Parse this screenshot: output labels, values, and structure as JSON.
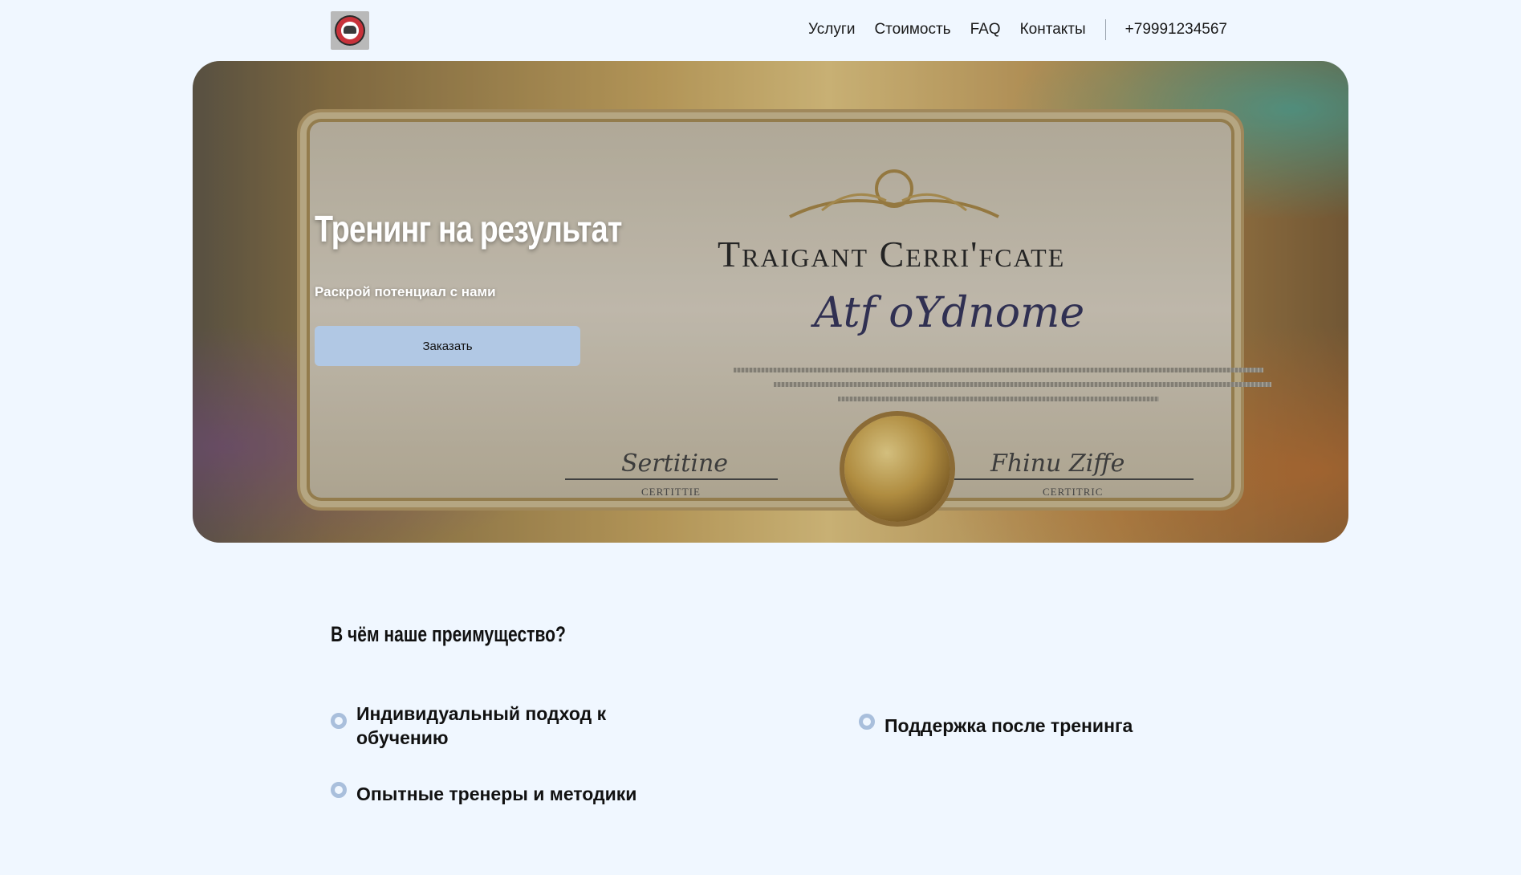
{
  "header": {
    "logo_icon": "company-logo",
    "nav": [
      {
        "label": "Услуги"
      },
      {
        "label": "Стоимость"
      },
      {
        "label": "FAQ"
      },
      {
        "label": "Контакты"
      }
    ],
    "phone": "+79991234567"
  },
  "hero": {
    "title": "Тренинг на результат",
    "subtitle": "Раскрой потенциал с нами",
    "button_label": "Заказать",
    "button_color": "#b1c8e4",
    "image": {
      "cert_title": "Traigant Cerri'fcate",
      "cert_script": "Atf oYdnome",
      "sig_left": "Sertitine",
      "sig_right": "Fhinu Ziffe",
      "sig_left_caption": "CERTITTIE",
      "sig_right_caption": "CERTITRIC"
    }
  },
  "advantages": {
    "title": "В чём наше преимущество?",
    "bullet_color": "#a9bfdc",
    "items": [
      {
        "text": "Индивидуальный подход к обучению"
      },
      {
        "text": "Поддержка после тренинга"
      },
      {
        "text": "Опытные тренеры и методики"
      }
    ]
  }
}
